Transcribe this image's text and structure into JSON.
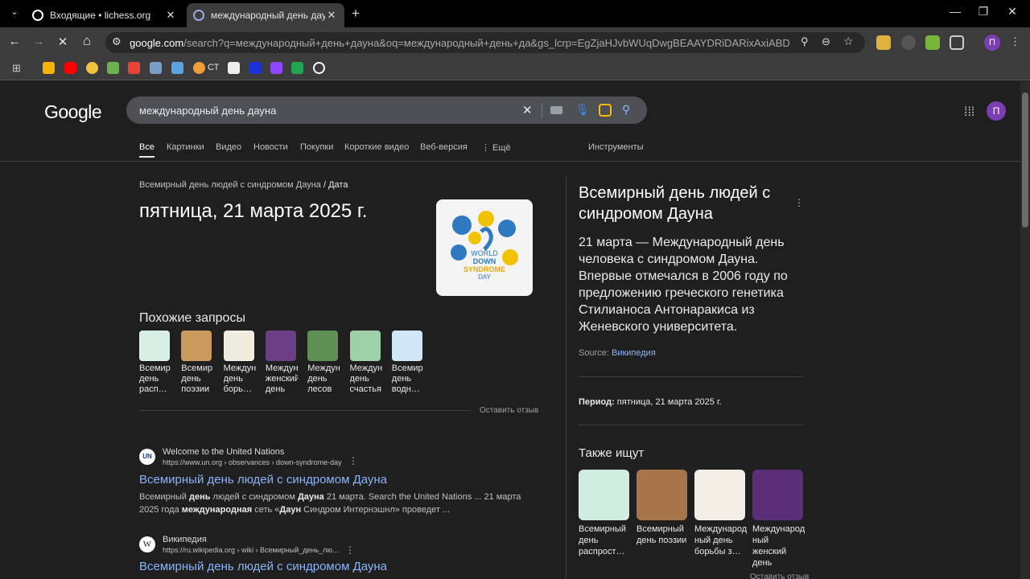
{
  "browser": {
    "tabs": [
      {
        "title": "Входящие • lichess.org",
        "close": "✕"
      },
      {
        "title": "международный день дауна -",
        "close": "✕"
      }
    ],
    "new_tab": "+",
    "window_controls": {
      "minimize": "—",
      "restore": "❐",
      "close": "✕"
    },
    "nav": {
      "back": "←",
      "forward": "→",
      "stop": "✕",
      "home": "⌂"
    },
    "url_host": "google.com",
    "url_rest": "/search?q=международный+день+дауна&oq=международный+день+да&gs_lcrp=EgZjaHJvbWUqDwgBEAAYDRiDARixAxiABDIGCAAQRRg5M...",
    "bookmarks": [
      {
        "label": "СТ"
      }
    ],
    "profile_initial": "П"
  },
  "google": {
    "logo": "Google",
    "query": "международный день дауна",
    "clear": "✕",
    "profile_initial": "П",
    "tabs": [
      "Все",
      "Картинки",
      "Видео",
      "Новости",
      "Покупки",
      "Короткие видео",
      "Веб-версия",
      "⋮ Ещё"
    ],
    "tools": "Инструменты",
    "breadcrumb": {
      "parent": "Всемирный день людей с синдромом Дауна",
      "sep": "/",
      "current": "Дата"
    },
    "answer_date": "пятница, 21 марта 2025 г.",
    "answer_image": {
      "line1": "WORLD",
      "line2": "DOWN",
      "line3": "SYNDROME",
      "line4": "DAY"
    },
    "related_title": "Похожие запросы",
    "related": [
      {
        "l1": "Всемир",
        "l2": "день",
        "l3": "расп…",
        "color": "#d9efe6"
      },
      {
        "l1": "Всемир",
        "l2": "день",
        "l3": "поэзии",
        "color": "#c99a5b"
      },
      {
        "l1": "Междун",
        "l2": "день",
        "l3": "борь…",
        "color": "#f0ece0"
      },
      {
        "l1": "Междун",
        "l2": "женский",
        "l3": "день",
        "color": "#6a3f86"
      },
      {
        "l1": "Междун",
        "l2": "день",
        "l3": "лесов",
        "color": "#5f8f55"
      },
      {
        "l1": "Междун",
        "l2": "день",
        "l3": "счастья",
        "color": "#9fd1a9"
      },
      {
        "l1": "Всемир",
        "l2": "день",
        "l3": "водн…",
        "color": "#cfe7f6"
      }
    ],
    "feedback": "Оставить отзыв",
    "results": [
      {
        "fav": "UN",
        "site": "Welcome to the United Nations",
        "url": "https://www.un.org › observances › down-syndrome-day",
        "title": "Всемирный день людей с синдромом Дауна",
        "snippet_a": "Всемирный ",
        "snippet_b": "день",
        "snippet_c": " людей с синдромом ",
        "snippet_d": "Дауна",
        "snippet_e": " 21 марта. Search the United Nations ... 21 марта 2025 года ",
        "snippet_f": "международная",
        "snippet_g": " сеть «",
        "snippet_h": "Даун",
        "snippet_i": " Синдром Интернэшнл» проведет ..."
      },
      {
        "fav": "W",
        "site": "Википедия",
        "url": "https://ru.wikipedia.org › wiki › Всемирный_день_лю...",
        "title": "Всемирный день людей с синдромом Дауна"
      }
    ],
    "kp": {
      "title": "Всемирный день людей с синдромом Дауна",
      "description": "21 марта — Международный день человека с синдромом Дауна. Впервые отмечался в 2006 году по предложению греческого генетика Стилианоса Антонаракиса из Женевского университета.",
      "source_label": "Source:",
      "source_link": "Википедия",
      "period_label": "Период:",
      "period_value": "пятница, 21 марта 2025 г.",
      "also_title": "Также ищут",
      "also": [
        {
          "l1": "Всемирный",
          "l2": "день",
          "l3": "распрост…",
          "color": "#cfeee0"
        },
        {
          "l1": "Всемирный",
          "l2": "день поэзии",
          "l3": "",
          "color": "#a8744a"
        },
        {
          "l1": "Международ",
          "l2": "ный день",
          "l3": "борьбы з…",
          "color": "#f3efe6"
        },
        {
          "l1": "Международ",
          "l2": "ный женский",
          "l3": "день",
          "color": "#5a2e78"
        }
      ],
      "bottom_feedback": "Оставить отзыв"
    }
  }
}
